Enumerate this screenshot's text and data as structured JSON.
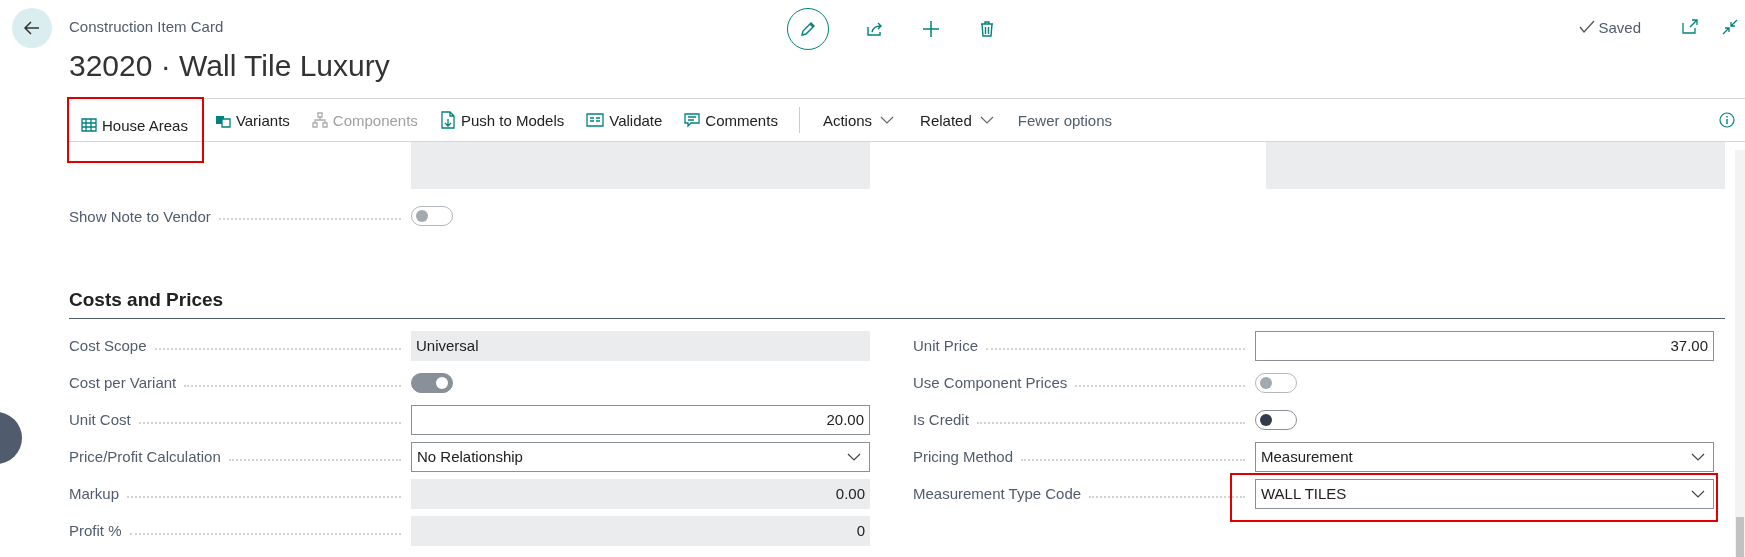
{
  "header": {
    "breadcrumb": "Construction Item Card",
    "title": "32020 · Wall Tile Luxury",
    "status": "Saved"
  },
  "toolbar": {
    "items": [
      {
        "label": "House Areas",
        "disabled": false,
        "highlighted": true
      },
      {
        "label": "Variants",
        "disabled": false,
        "highlighted": false
      },
      {
        "label": "Components",
        "disabled": true,
        "highlighted": false
      },
      {
        "label": "Push to Models",
        "disabled": false,
        "highlighted": false
      },
      {
        "label": "Validate",
        "disabled": false,
        "highlighted": false
      },
      {
        "label": "Comments",
        "disabled": false,
        "highlighted": false
      }
    ],
    "menus": [
      "Actions",
      "Related"
    ],
    "fewer": "Fewer options"
  },
  "upper_fields": [
    {
      "label": "Show Note to Vendor",
      "kind": "toggle",
      "on": false,
      "disabled": true
    }
  ],
  "section": {
    "title": "Costs and Prices",
    "left": [
      {
        "label": "Cost Scope",
        "kind": "text",
        "value": "Universal"
      },
      {
        "label": "Cost per Variant",
        "kind": "toggle",
        "on": true,
        "disabled": true
      },
      {
        "label": "Unit Cost",
        "kind": "input",
        "value": "20.00"
      },
      {
        "label": "Price/Profit Calculation",
        "kind": "select",
        "value": "No Relationship",
        "highlighted": false
      },
      {
        "label": "Markup",
        "kind": "number",
        "value": "0.00"
      },
      {
        "label": "Profit %",
        "kind": "number",
        "value": "0"
      }
    ],
    "right": [
      {
        "label": "Unit Price",
        "kind": "input",
        "value": "37.00"
      },
      {
        "label": "Use Component Prices",
        "kind": "toggle",
        "on": false,
        "disabled": true
      },
      {
        "label": "Is Credit",
        "kind": "toggle",
        "on": false,
        "disabled": false
      },
      {
        "label": "Pricing Method",
        "kind": "select",
        "value": "Measurement",
        "highlighted": false
      },
      {
        "label": "Measurement Type Code",
        "kind": "select",
        "value": "WALL TILES",
        "highlighted": true
      }
    ]
  }
}
